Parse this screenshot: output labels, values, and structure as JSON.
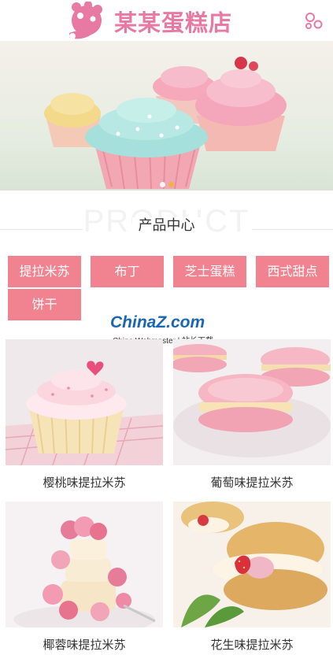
{
  "header": {
    "brand": "某某蛋糕店",
    "logo_icon": "cupcake-logo-icon",
    "menu_icon": "circles-menu-icon"
  },
  "banner": {
    "slides": 2,
    "active_slide": 2
  },
  "section": {
    "title": "产品中心",
    "bg_text": "PRODUCT"
  },
  "categories": [
    "提拉米苏",
    "布丁",
    "芝士蛋糕",
    "西式甜点",
    "饼干"
  ],
  "watermark": {
    "main": "ChinaZ.com",
    "sub": "China Webmaster | 站长下载"
  },
  "products": [
    {
      "name": "樱桃味提拉米苏"
    },
    {
      "name": "葡萄味提拉米苏"
    },
    {
      "name": "椰蓉味提拉米苏"
    },
    {
      "name": "花生味提拉米苏"
    }
  ],
  "colors": {
    "brand_pink": "#e879a3",
    "category_bg": "#f0838f",
    "dot_active": "#f0b343"
  }
}
